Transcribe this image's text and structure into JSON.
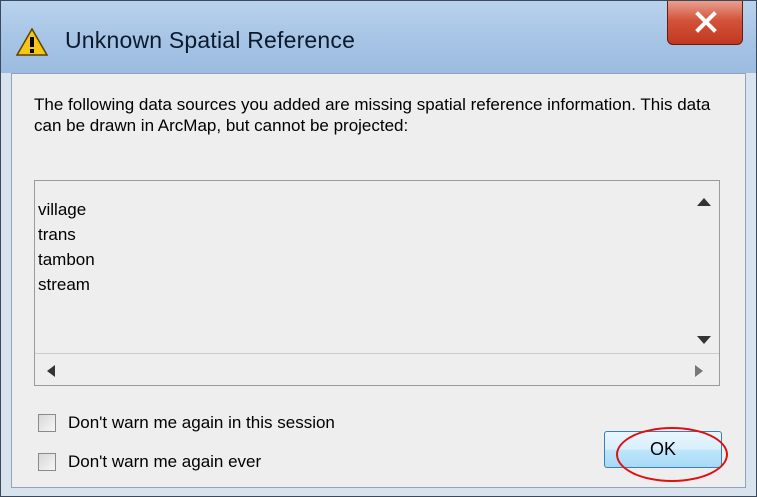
{
  "window": {
    "title": "Unknown Spatial Reference",
    "title_icon": "warning-icon",
    "close_icon": "close-icon"
  },
  "message": "The following data sources you added are missing spatial reference information. This data can be drawn in ArcMap, but cannot be projected:",
  "data_sources": [
    "village",
    "trans",
    "tambon",
    "stream"
  ],
  "checkboxes": {
    "session_label": "Don't warn me again in this session",
    "session_checked": false,
    "ever_label": "Don't warn me again ever",
    "ever_checked": false
  },
  "ok_label": "OK",
  "colors": {
    "highlight": "#e01010",
    "close_button": "#c9432b",
    "title_bar": "#a9c6e6"
  }
}
